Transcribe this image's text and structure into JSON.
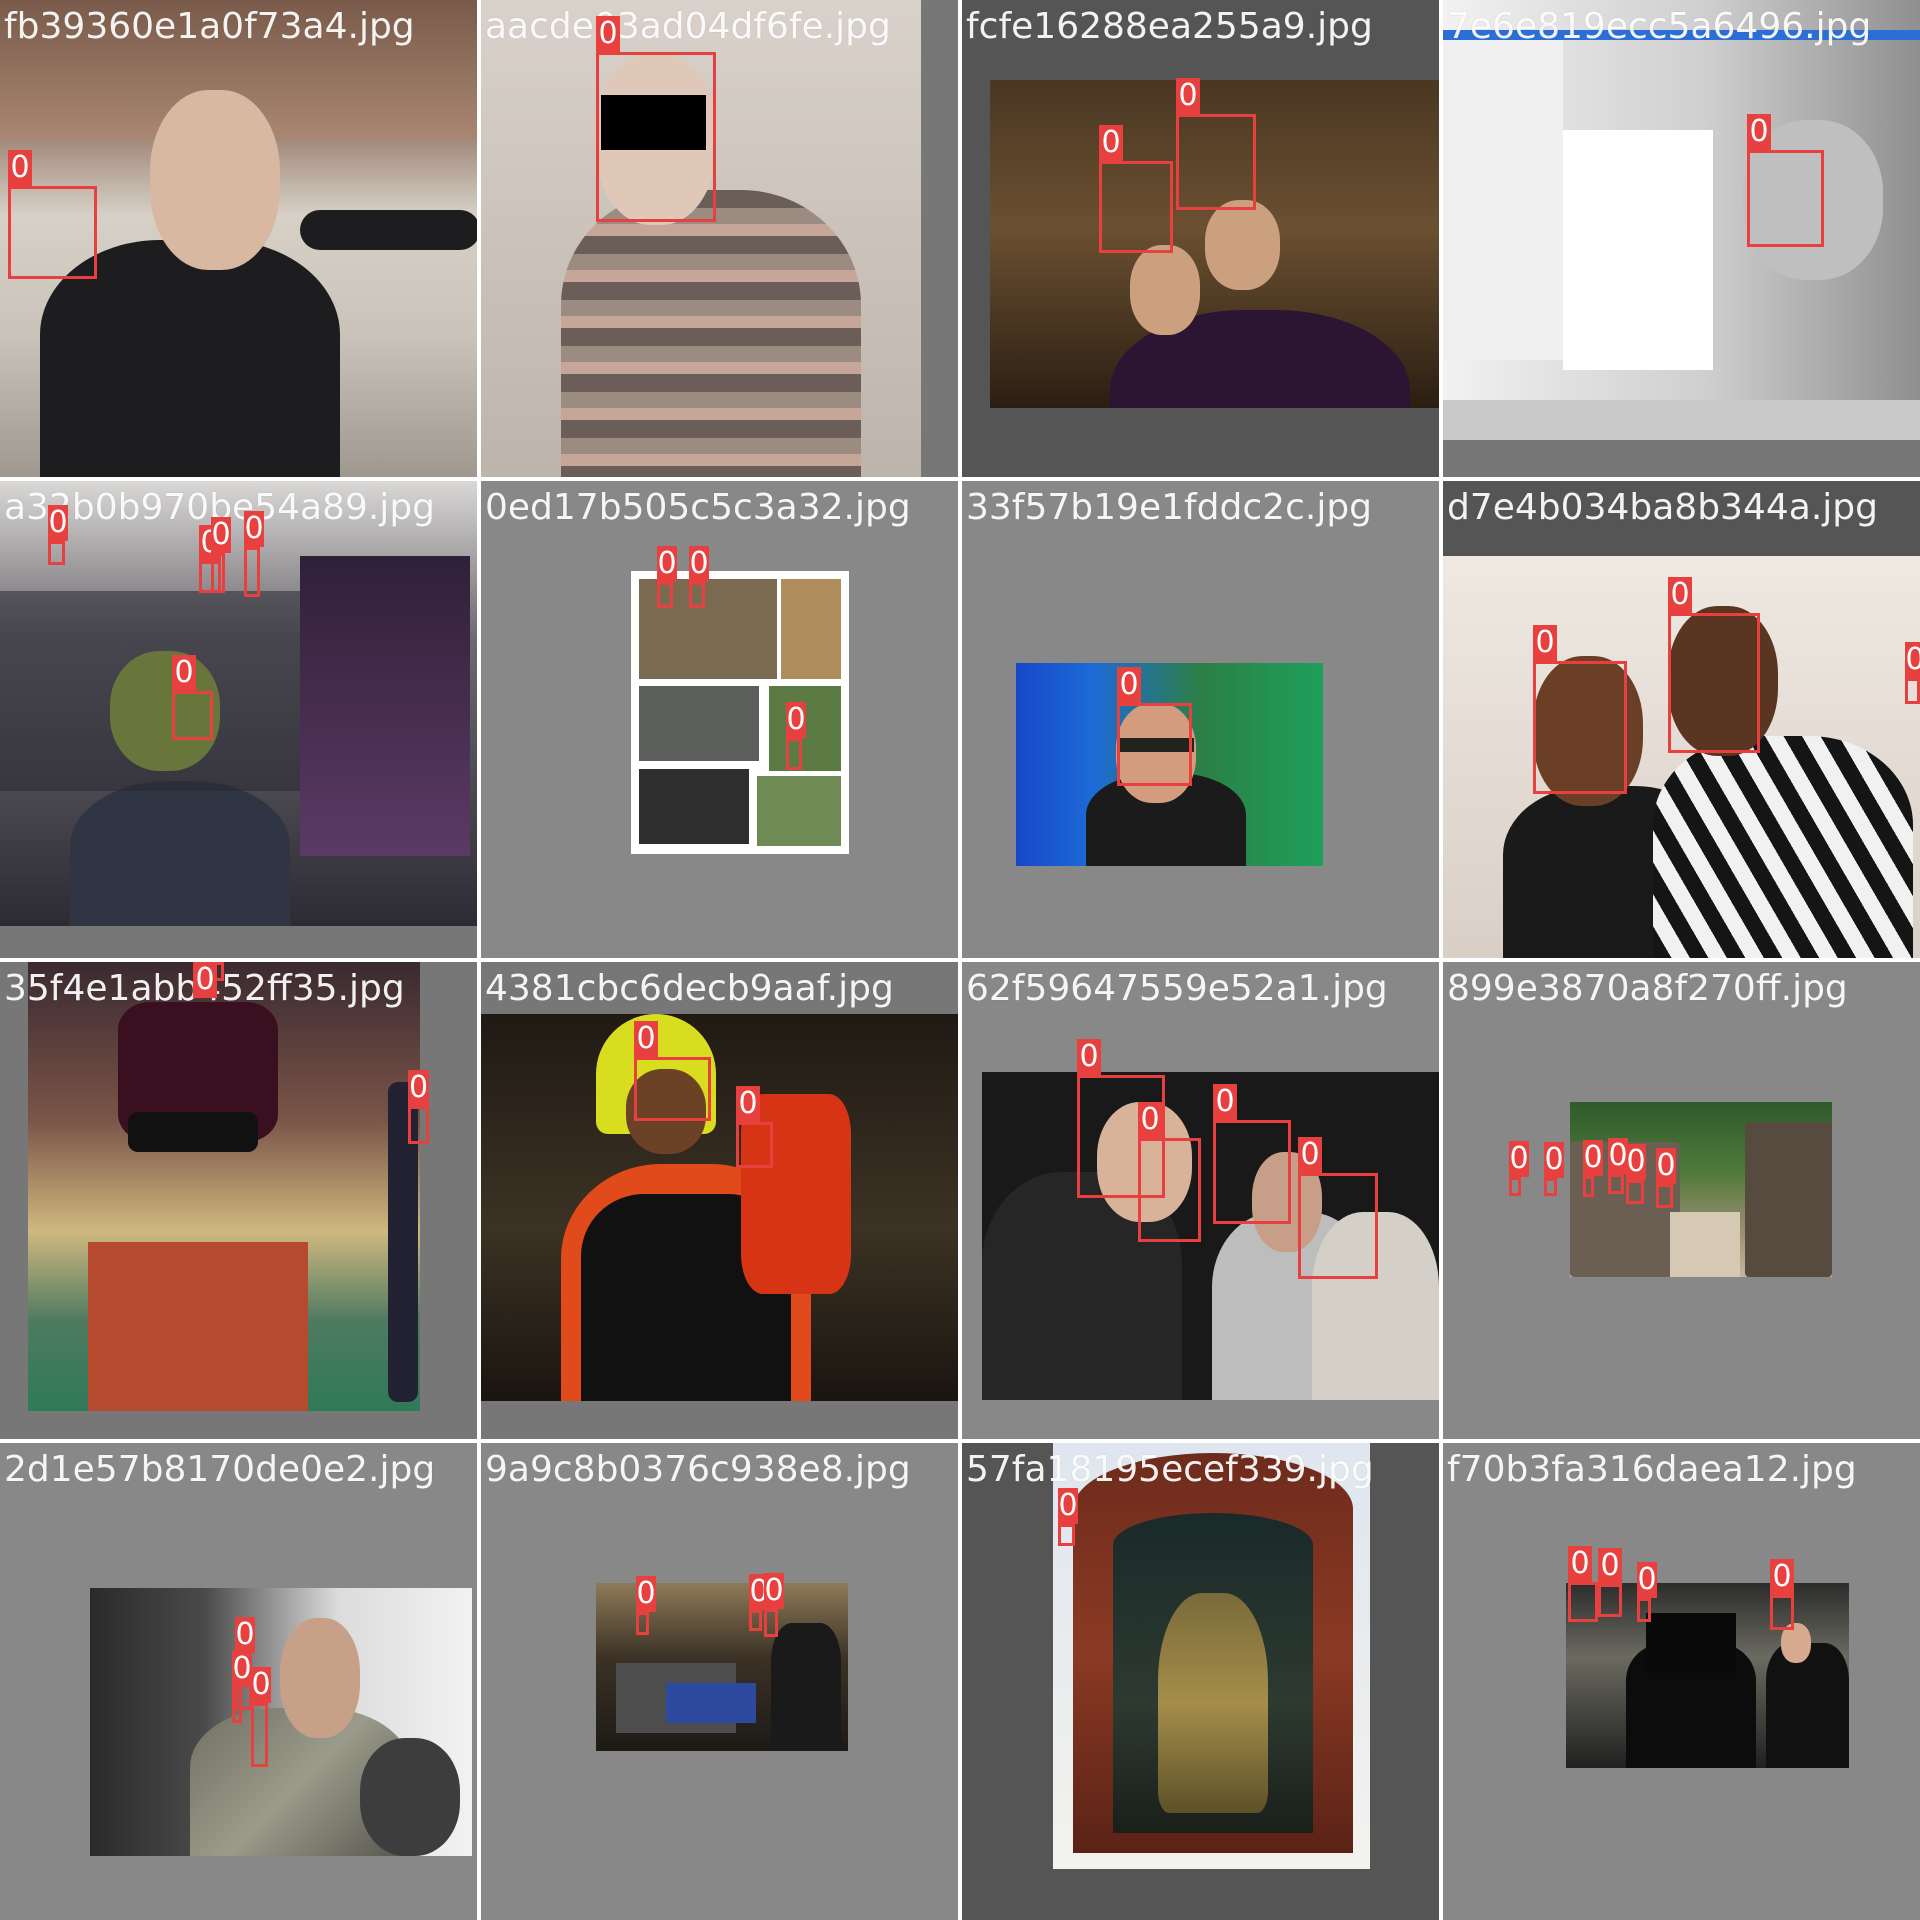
{
  "colors": {
    "box": "#e8403f",
    "label_text": "#ffffff",
    "filename_text": "#ffffff",
    "gutter": "#ffffff"
  },
  "tiles": [
    {
      "filename": "fb39360e1a0f73a4.jpg",
      "boxes": [
        {
          "label": "0"
        }
      ]
    },
    {
      "filename": "aacde03ad04df6fe.jpg",
      "boxes": [
        {
          "label": "0"
        }
      ]
    },
    {
      "filename": "fcfe16288ea255a9.jpg",
      "boxes": [
        {
          "label": "0"
        },
        {
          "label": "0"
        }
      ]
    },
    {
      "filename": "7e6e819ecc5a6496.jpg",
      "boxes": [
        {
          "label": "0"
        }
      ]
    },
    {
      "filename": "a32b0b970be54a89.jpg",
      "boxes": [
        {
          "label": "0"
        },
        {
          "label": "0"
        },
        {
          "label": "0"
        },
        {
          "label": "0"
        },
        {
          "label": "0"
        }
      ]
    },
    {
      "filename": "0ed17b505c5c3a32.jpg",
      "boxes": [
        {
          "label": "0"
        },
        {
          "label": "0"
        },
        {
          "label": "0"
        }
      ]
    },
    {
      "filename": "33f57b19e1fddc2c.jpg",
      "boxes": [
        {
          "label": "0"
        }
      ]
    },
    {
      "filename": "d7e4b034ba8b344a.jpg",
      "boxes": [
        {
          "label": "0"
        },
        {
          "label": "0"
        },
        {
          "label": "0"
        }
      ]
    },
    {
      "filename": "35f4e1abb452ff35.jpg",
      "boxes": [
        {
          "label": "0"
        },
        {
          "label": "0"
        }
      ]
    },
    {
      "filename": "4381cbc6decb9aaf.jpg",
      "boxes": [
        {
          "label": "0"
        },
        {
          "label": "0"
        }
      ]
    },
    {
      "filename": "62f59647559e52a1.jpg",
      "boxes": [
        {
          "label": "0"
        },
        {
          "label": "0"
        },
        {
          "label": "0"
        },
        {
          "label": "0"
        }
      ]
    },
    {
      "filename": "899e3870a8f270ff.jpg",
      "boxes": [
        {
          "label": "0"
        },
        {
          "label": "0"
        },
        {
          "label": "0"
        },
        {
          "label": "0"
        },
        {
          "label": "0"
        },
        {
          "label": "0"
        }
      ]
    },
    {
      "filename": "2d1e57b8170de0e2.jpg",
      "boxes": [
        {
          "label": "0"
        },
        {
          "label": "0"
        },
        {
          "label": "0"
        }
      ]
    },
    {
      "filename": "9a9c8b0376c938e8.jpg",
      "boxes": [
        {
          "label": "0"
        },
        {
          "label": "0"
        },
        {
          "label": "0"
        }
      ]
    },
    {
      "filename": "57fa18195ecef339.jpg",
      "boxes": [
        {
          "label": "0"
        }
      ]
    },
    {
      "filename": "f70b3fa316daea12.jpg",
      "boxes": [
        {
          "label": "0"
        },
        {
          "label": "0"
        },
        {
          "label": "0"
        },
        {
          "label": "0"
        }
      ]
    }
  ]
}
